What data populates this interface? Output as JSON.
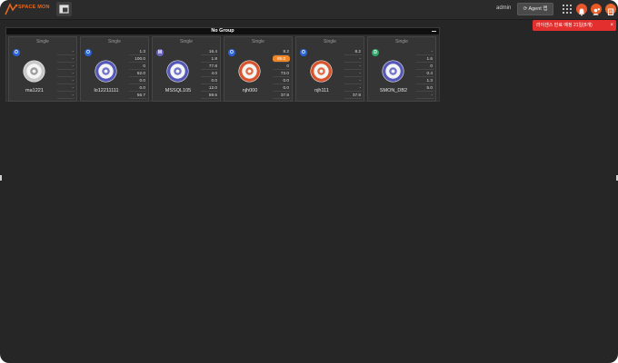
{
  "header": {
    "logo_text": "SPACE MON",
    "user": "admin",
    "agent_button_label": "Agent 랩",
    "icon_colors": [
      "#e8562d",
      "#e85a23",
      "#e86a2f"
    ]
  },
  "license": {
    "message": "라이센스 만료 예정 21일(8개)",
    "close": "×"
  },
  "group": {
    "title": "No Group",
    "cards": [
      {
        "type": "Single",
        "badge": "O",
        "badge_color": "#2b63d9",
        "name": "ma1221",
        "ring": "#c8c8c8",
        "core": "#9c9c9c",
        "metrics": [
          "-",
          "-",
          "-",
          "-",
          "-",
          "-",
          "-"
        ],
        "alert": -1
      },
      {
        "type": "Single",
        "badge": "O",
        "badge_color": "#2b63d9",
        "name": "lo12211111",
        "ring": "#5458b8",
        "core": "#6f73cc",
        "metrics": [
          "1.3",
          "100.0",
          "0",
          "62.0",
          "0.0",
          "0.0",
          "56.7"
        ],
        "alert": -1
      },
      {
        "type": "Single",
        "badge": "M",
        "badge_color": "#6a66c4",
        "name": "MSSQL105",
        "ring": "#5458b8",
        "core": "#6f73cc",
        "metrics": [
          "16.4",
          "1.8",
          "77.8",
          "4.0",
          "0.0",
          "12.0",
          "59.6"
        ],
        "alert": -1
      },
      {
        "type": "Single",
        "badge": "O",
        "badge_color": "#2b63d9",
        "name": "njh000",
        "ring": "#d8542d",
        "core": "#e06a40",
        "metrics": [
          "8.2",
          "89.0",
          "0",
          "73.0",
          "0.0",
          "0.0",
          "37.8"
        ],
        "alert": 1
      },
      {
        "type": "Single",
        "badge": "O",
        "badge_color": "#2b63d9",
        "name": "njh111",
        "ring": "#d8542d",
        "core": "#e06a40",
        "metrics": [
          "8.2",
          "-",
          "-",
          "-",
          "-",
          "-",
          "37.8"
        ],
        "alert": -1
      },
      {
        "type": "Single",
        "badge": "D",
        "badge_color": "#2fa86a",
        "name": "SMON_DB2",
        "ring": "#5458b8",
        "core": "#6f73cc",
        "metrics": [
          "-",
          "1.6",
          "0",
          "0.4",
          "1.3",
          "5.0",
          "-"
        ],
        "alert": -1
      }
    ]
  }
}
